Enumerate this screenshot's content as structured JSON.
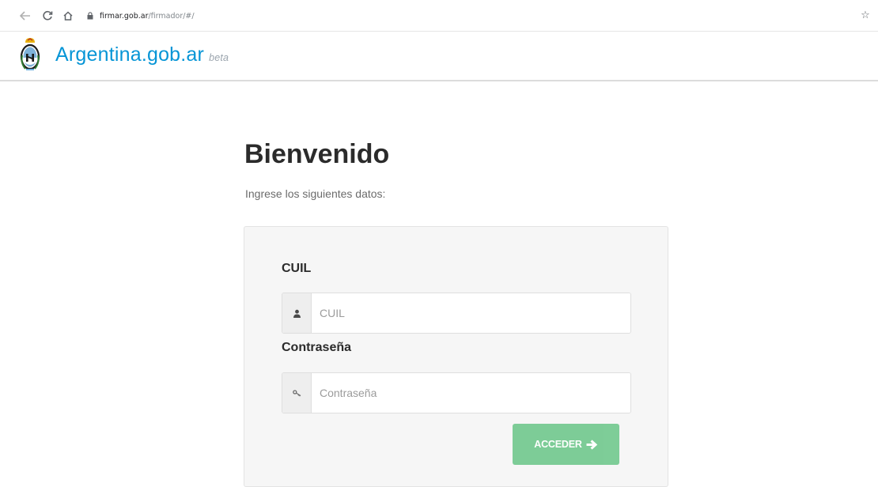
{
  "browser": {
    "url_host": "firmar.gob.ar",
    "url_path": "/firmador/#/",
    "icons": {
      "back": "arrow-left-icon",
      "reload": "reload-icon",
      "home": "home-icon",
      "lock": "lock-icon",
      "bookmark": "star-icon"
    }
  },
  "header": {
    "brand": "Argentina.gob.ar",
    "badge": "beta",
    "brand_color": "#0695d6"
  },
  "main": {
    "title": "Bienvenido",
    "subtitle": "Ingrese los siguientes datos:"
  },
  "form": {
    "cuil_label": "CUIL",
    "cuil_placeholder": "CUIL",
    "cuil_value": "",
    "password_label": "Contraseña",
    "password_placeholder": "Contraseña",
    "password_value": "",
    "submit_label": "ACCEDER",
    "submit_color": "#73c98f"
  }
}
